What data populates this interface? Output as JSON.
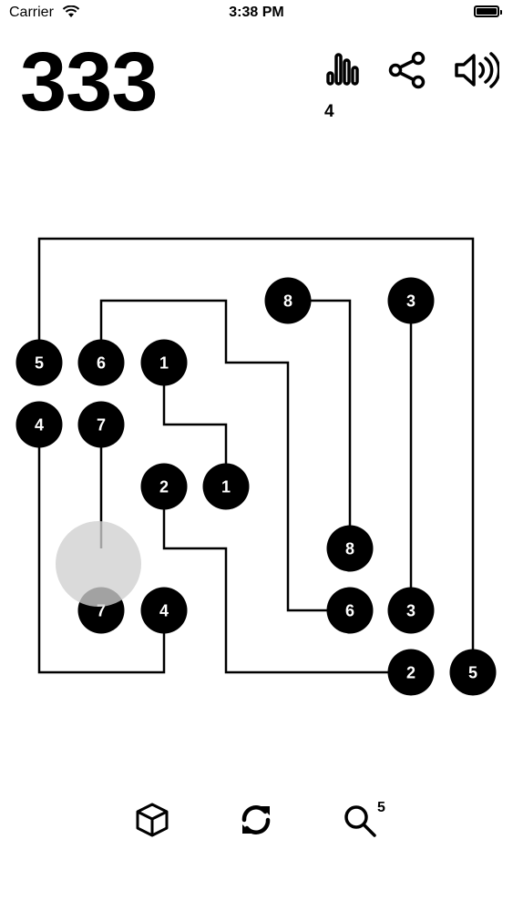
{
  "status_bar": {
    "carrier": "Carrier",
    "time": "3:38 PM"
  },
  "score": "333",
  "toolbar": {
    "stats_icon": "bar-chart-icon",
    "stats_count": "4",
    "share_icon": "share-icon",
    "sound_icon": "speaker-icon"
  },
  "board": {
    "nodes": [
      {
        "label": "8"
      },
      {
        "label": "3"
      },
      {
        "label": "5"
      },
      {
        "label": "6"
      },
      {
        "label": "1"
      },
      {
        "label": "4"
      },
      {
        "label": "7"
      },
      {
        "label": "2"
      },
      {
        "label": "1"
      },
      {
        "label": "8"
      },
      {
        "label": "7"
      },
      {
        "label": "4"
      },
      {
        "label": "6"
      },
      {
        "label": "3"
      },
      {
        "label": "2"
      },
      {
        "label": "5"
      }
    ]
  },
  "bottom_bar": {
    "cube_icon": "cube-icon",
    "restart_icon": "refresh-icon",
    "hint_icon": "magnifier-icon",
    "hint_count": "5"
  },
  "colors": {
    "node_fill": "#000000",
    "node_text": "#ffffff",
    "line": "#000000",
    "cursor": "#d0d0d0"
  }
}
